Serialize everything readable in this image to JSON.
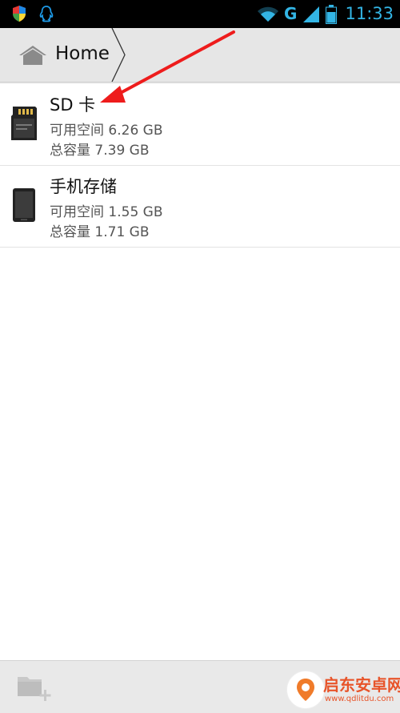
{
  "status_bar": {
    "network_type": "G",
    "time": "11:33"
  },
  "breadcrumb": {
    "home_label": "Home"
  },
  "storage": [
    {
      "title": "SD 卡",
      "available": "可用空间 6.26 GB",
      "total": "总容量 7.39 GB",
      "icon": "sd-card-icon"
    },
    {
      "title": "手机存储",
      "available": "可用空间 1.55 GB",
      "total": "总容量 1.71 GB",
      "icon": "phone-icon"
    }
  ],
  "annotation": {
    "arrow_color": "#ee1c1c"
  },
  "watermark": {
    "title": "启东安卓网",
    "url": "www.qdlitdu.com"
  },
  "colors": {
    "status_accent": "#33b5e5",
    "breadcrumb_bg": "#e6e6e6",
    "watermark": "#e8542a"
  }
}
